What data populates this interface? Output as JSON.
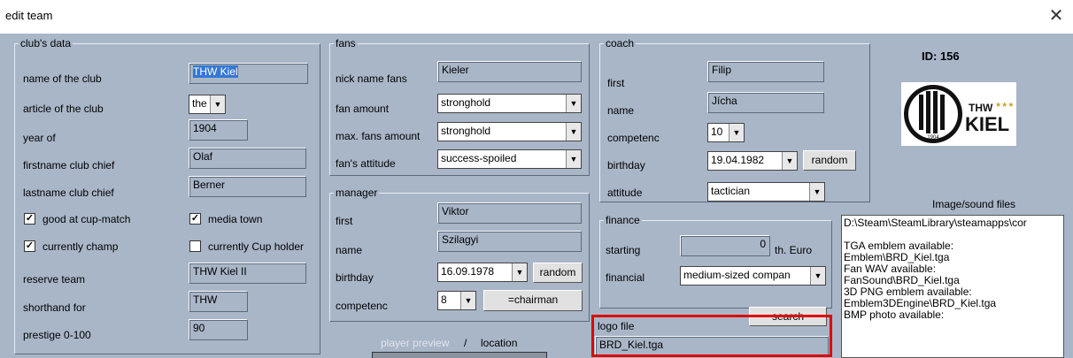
{
  "window": {
    "title": "edit team",
    "close_icon": "close-icon"
  },
  "club": {
    "group": "club's data",
    "name_label": "name of the club",
    "name_value": "THW Kiel",
    "article_label": "article of the club",
    "article_value": "the",
    "year_label": "year of",
    "year_value": "1904",
    "chief_first_label": "firstname club chief",
    "chief_first_value": "Olaf",
    "chief_last_label": "lastname club chief",
    "chief_last_value": "Berner",
    "cup_match": "good at cup-match",
    "media_town": "media town",
    "champ": "currently champ",
    "cup_holder": "currently Cup holder",
    "reserve_label": "reserve team",
    "reserve_value": "THW Kiel II",
    "short_label": "shorthand for",
    "short_value": "THW",
    "prestige_label": "prestige 0-100",
    "prestige_value": "90",
    "checks": {
      "cup_match": true,
      "media_town": true,
      "champ": true,
      "cup_holder": false
    }
  },
  "fans": {
    "group": "fans",
    "nick_label": "nick name fans",
    "nick_value": "Kieler",
    "amount_label": "fan amount",
    "amount_value": "stronghold",
    "max_label": "max. fans amount",
    "max_value": "stronghold",
    "attitude_label": "fan's attitude",
    "attitude_value": "success-spoiled"
  },
  "manager": {
    "group": "manager",
    "first_label": "first",
    "first_value": "Viktor",
    "name_label": "name",
    "name_value": "Szilagyi",
    "birthday_label": "birthday",
    "birthday_value": "16.09.1978",
    "random": "random",
    "comp_label": "competenc",
    "comp_value": "8",
    "chairman": "=chairman"
  },
  "preview": {
    "player_preview": "player preview",
    "sep": "/",
    "location": "location"
  },
  "coach": {
    "group": "coach",
    "first_label": "first",
    "first_value": "Filip",
    "name_label": "name",
    "name_value": "Jícha",
    "comp_label": "competenc",
    "comp_value": "10",
    "birthday_label": "birthday",
    "birthday_value": "19.04.1982",
    "random": "random",
    "attitude_label": "attitude",
    "attitude_value": "tactician"
  },
  "finance": {
    "group": "finance",
    "starting_label": "starting",
    "starting_value": "0",
    "unit": "th. Euro",
    "financial_label": "financial",
    "financial_value": "medium-sized compan"
  },
  "logo": {
    "label": "logo file",
    "value": "BRD_Kiel.tga",
    "search": "search"
  },
  "right": {
    "id": "ID: 156",
    "logo_text": "THW",
    "logo_text2": "KIEL",
    "logo_year": "1904",
    "files_label": "Image/sound files",
    "lines": [
      "D:\\Steam\\SteamLibrary\\steamapps\\cor",
      "",
      "TGA emblem available:",
      "Emblem\\BRD_Kiel.tga",
      "Fan WAV available:",
      "FanSound\\BRD_Kiel.tga",
      "3D PNG emblem available:",
      "Emblem3DEngine\\BRD_Kiel.tga",
      "BMP photo available:"
    ]
  },
  "colors": {
    "panel": "#a9b6c8",
    "highlight": "#e00000",
    "selection": "#3478d4"
  }
}
